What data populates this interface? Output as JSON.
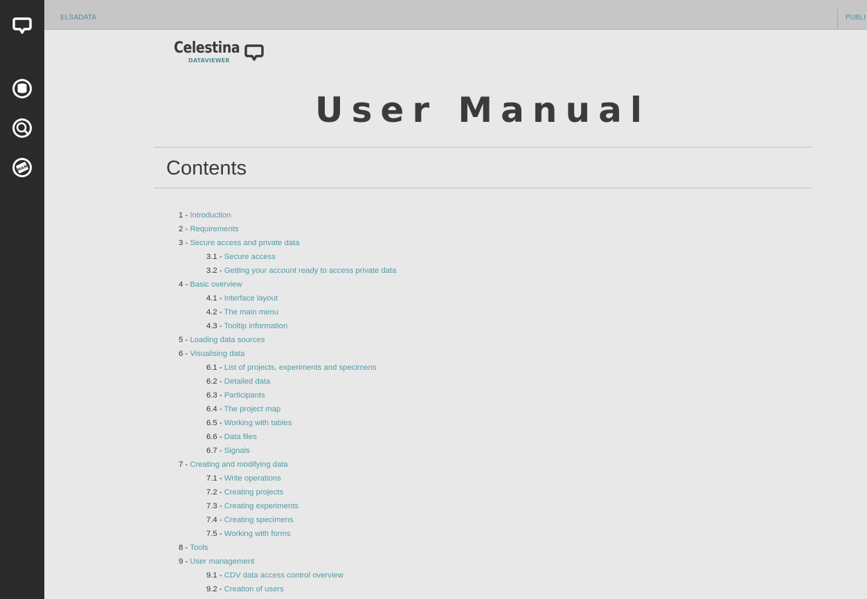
{
  "topbar": {
    "left_label": "ELSADATA",
    "right_label": "PUBLI"
  },
  "sidebar": {
    "icons": [
      "logo-bubble-icon",
      "database-icon",
      "search-icon",
      "manual-icon"
    ],
    "manual_icon_text": "MAN"
  },
  "logo": {
    "name": "Celestina",
    "sub": "DATAVIEWER"
  },
  "title": "User Manual",
  "contents_heading": "Contents",
  "toc": [
    {
      "num": "1 - ",
      "label": "Introduction",
      "level": 1
    },
    {
      "num": "2 - ",
      "label": "Requirements",
      "level": 1
    },
    {
      "num": "3 - ",
      "label": "Secure access and private data",
      "level": 1
    },
    {
      "num": "3.1 - ",
      "label": "Secure access",
      "level": 2
    },
    {
      "num": "3.2 - ",
      "label": "Getting your account ready to access private data",
      "level": 2
    },
    {
      "num": "4 - ",
      "label": "Basic overview",
      "level": 1
    },
    {
      "num": "4.1 - ",
      "label": "Interface layout",
      "level": 2
    },
    {
      "num": "4.2 - ",
      "label": "The main menu",
      "level": 2
    },
    {
      "num": "4.3 - ",
      "label": "Tooltip information",
      "level": 2
    },
    {
      "num": "5 - ",
      "label": "Loading data sources",
      "level": 1
    },
    {
      "num": "6 - ",
      "label": "Visualising data",
      "level": 1
    },
    {
      "num": "6.1 - ",
      "label": "List of projects, experiments and specimens",
      "level": 2
    },
    {
      "num": "6.2 - ",
      "label": "Detailed data",
      "level": 2
    },
    {
      "num": "6.3 - ",
      "label": "Participants",
      "level": 2
    },
    {
      "num": "6.4 - ",
      "label": "The project map",
      "level": 2
    },
    {
      "num": "6.5 - ",
      "label": "Working with tables",
      "level": 2
    },
    {
      "num": "6.6 - ",
      "label": "Data files",
      "level": 2
    },
    {
      "num": "6.7 - ",
      "label": "Signals",
      "level": 2
    },
    {
      "num": "7 - ",
      "label": "Creating and modifying data",
      "level": 1
    },
    {
      "num": "7.1 - ",
      "label": "Write operations",
      "level": 2
    },
    {
      "num": "7.2 - ",
      "label": "Creating projects",
      "level": 2
    },
    {
      "num": "7.3 - ",
      "label": "Creating experiments",
      "level": 2
    },
    {
      "num": "7.4 - ",
      "label": "Creating specimens",
      "level": 2
    },
    {
      "num": "7.5 - ",
      "label": "Working with forms",
      "level": 2
    },
    {
      "num": "8 - ",
      "label": "Tools",
      "level": 1
    },
    {
      "num": "9 - ",
      "label": "User management",
      "level": 1
    },
    {
      "num": "9.1 - ",
      "label": "CDV data access control overview",
      "level": 2
    },
    {
      "num": "9.2 - ",
      "label": "Creation of users",
      "level": 2
    }
  ]
}
